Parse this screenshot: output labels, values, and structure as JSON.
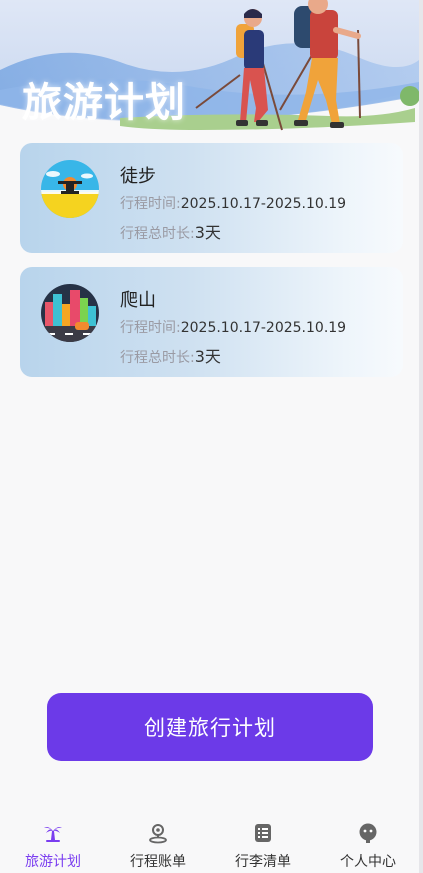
{
  "hero": {
    "title": "旅游计划"
  },
  "plans": [
    {
      "name": "徒步",
      "time_label": "行程时间:",
      "time_value": "2025.10.17-2025.10.19",
      "duration_label": "行程总时长:",
      "duration_value": "3天",
      "thumb_icon": "beach-sunset-icon"
    },
    {
      "name": "爬山",
      "time_label": "行程时间:",
      "time_value": "2025.10.17-2025.10.19",
      "duration_label": "行程总时长:",
      "duration_value": "3天",
      "thumb_icon": "city-buildings-icon"
    }
  ],
  "create_button": {
    "label": "创建旅行计划"
  },
  "tabbar": {
    "active_color": "#7a3df0",
    "items": [
      {
        "label": "旅游计划",
        "icon": "palm-tree-icon",
        "active": true
      },
      {
        "label": "行程账单",
        "icon": "location-pin-icon",
        "active": false
      },
      {
        "label": "行李清单",
        "icon": "checklist-icon",
        "active": false
      },
      {
        "label": "个人中心",
        "icon": "profile-face-icon",
        "active": false
      }
    ]
  },
  "colors": {
    "accent": "#6c3ae8",
    "card_gradient_start": "#b8d4ec",
    "card_gradient_end": "#f7fafd"
  }
}
